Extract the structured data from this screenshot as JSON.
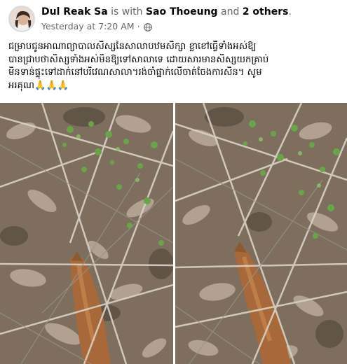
{
  "post": {
    "author": "Dul Reak Sa",
    "with_text": "is with",
    "tagged_person": "Sao Thoeung",
    "and_text": "and",
    "others": "2 others",
    "period": ".",
    "timestamp": "Yesterday at 7:20 AM",
    "separator": "·",
    "caption_lines": [
      "ជម្រាបជូនអាណាព្យាបាលសិស្សនៃសាលាបឋមសិក្សា ខ្លាខៅធ្វើទាំងអស់ឱ្យ",
      "បានជ្រាបថាសិស្សទាំងអស់មិនឱ្យទៅសាលាទេ ដោយសារមានសិស្សយកគ្រាប់",
      "មិនទាន់ផ្ទុះទៅដាក់នៅបរិវេណសាលា។រង់ចាំផ្នាក់លើចាត់ចែងការសិន។ សូម",
      "អរគុណ🙏🙏🙏"
    ]
  },
  "icons": {
    "privacy": "globe-icon"
  },
  "colors": {
    "secondary_text": "#65676b",
    "primary_text": "#050505"
  }
}
